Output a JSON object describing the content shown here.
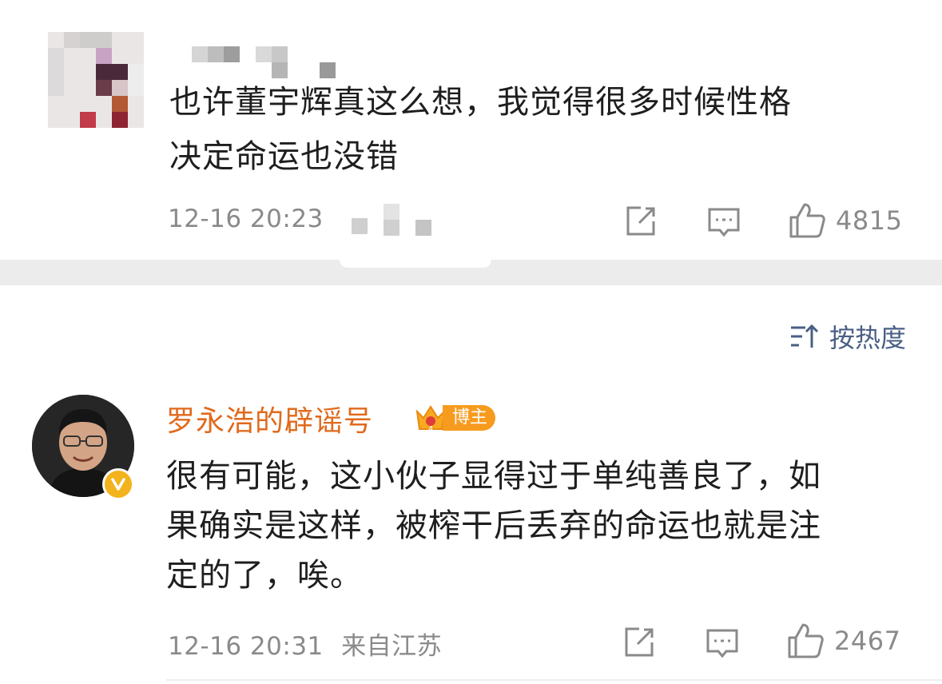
{
  "post": {
    "text_line1": "也许董宇辉真这么想，我觉得很多时候性格",
    "text_line2": "决定命运也没错",
    "timestamp": "12-16 20:23",
    "likes": "4815"
  },
  "sort": {
    "label": "按热度"
  },
  "comment": {
    "author": "罗永浩的辟谣号",
    "badge_label": "博主",
    "text_line1": "很有可能，这小伙子显得过于单纯善良了，如",
    "text_line2": "果确实是这样，被榨干后丢弃的命运也就是注",
    "text_line3": "定的了，唉。",
    "timestamp": "12-16 20:31",
    "location": "来自江苏",
    "likes": "2467"
  },
  "colors": {
    "author": "#e06a1c",
    "sort_text": "#4a5f86",
    "meta": "#8a8a8a",
    "verify": "#f3b31c",
    "badge": "#f79b1f"
  },
  "icons": [
    "share-icon",
    "comment-icon",
    "like-icon",
    "sort-icon",
    "verified-icon",
    "crown-icon"
  ]
}
